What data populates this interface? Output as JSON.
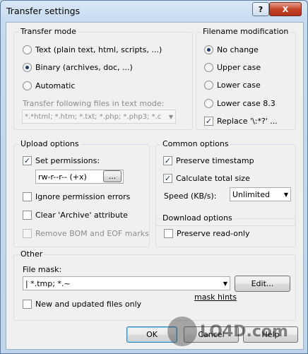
{
  "window": {
    "title": "Transfer settings"
  },
  "titlebar": {
    "help_glyph": "?",
    "close_glyph": "X"
  },
  "transfer_mode": {
    "title": "Transfer mode",
    "text_option": "Text (plain text, html, scripts, ...)",
    "binary_option": "Binary (archives, doc, ...)",
    "automatic_option": "Automatic",
    "following_label": "Transfer following files in text mode:",
    "text_mask_value": "*.*html; *.htm; *.txt; *.php; *.php3; *.c",
    "selected": "Binary (archives, doc, ...)"
  },
  "filename_mod": {
    "title": "Filename modification",
    "no_change": "No change",
    "upper_case": "Upper case",
    "lower_case": "Lower case",
    "lower_case_83": "Lower case 8.3",
    "replace": "Replace '\\:*?' ...",
    "selected": "No change"
  },
  "upload": {
    "title": "Upload options",
    "set_permissions": "Set permissions:",
    "permissions_value": "rw-r--r-- (+x)",
    "browse_label": "...",
    "ignore_errors": "Ignore permission errors",
    "clear_archive": "Clear 'Archive' attribute",
    "remove_bom": "Remove BOM and EOF marks"
  },
  "common": {
    "title": "Common options",
    "preserve_timestamp": "Preserve timestamp",
    "calculate_size": "Calculate total size",
    "speed_label": "Speed (KB/s):",
    "speed_value": "Unlimited"
  },
  "download": {
    "title": "Download options",
    "preserve_readonly": "Preserve read-only"
  },
  "other": {
    "title": "Other",
    "file_mask_label": "File mask:",
    "file_mask_value": "| *.tmp; *.~",
    "edit_button": "Edit...",
    "mask_hints": "mask hints",
    "new_updated": "New and updated files only"
  },
  "footer": {
    "ok": "OK",
    "cancel": "Cancel",
    "help": "Help"
  },
  "watermark": {
    "text": "LO4D.com"
  }
}
